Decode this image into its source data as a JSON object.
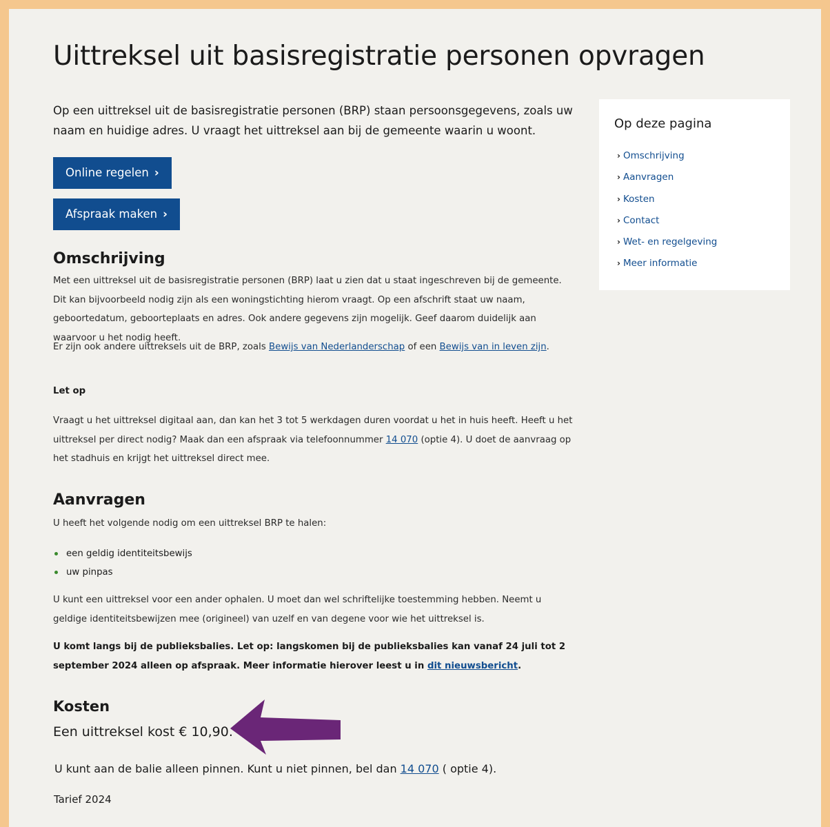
{
  "page": {
    "title": "Uittreksel uit basisregistratie personen opvragen",
    "intro": "Op een uittreksel uit de basisregistratie personen (BRP) staan persoonsgegevens, zoals uw naam en huidige adres. U vraagt het uittreksel aan bij de gemeente waarin u woont."
  },
  "buttons": {
    "online": "Online regelen",
    "afspraak": "Afspraak maken",
    "chevron": "›"
  },
  "omschrijving": {
    "heading": "Omschrijving",
    "p1": "Met een uittreksel uit de basisregistratie personen (BRP) laat u zien dat u staat ingeschreven bij de gemeente. Dit kan bijvoorbeeld nodig zijn als een woningstichting hierom vraagt. Op een afschrift staat uw naam, geboortedatum, geboorteplaats en adres. Ook andere gegevens zijn mogelijk. Geef daarom duidelijk aan waarvoor u het nodig heeft.",
    "p2_before": "Er zijn ook andere uittreksels uit de BRP, zoals ",
    "p2_link1": "Bewijs van Nederlanderschap",
    "p2_mid": " of een ",
    "p2_link2": "Bewijs van in leven zijn",
    "p2_end": ".",
    "letop_label": "Let op",
    "letop_before": "Vraagt u het uittreksel digitaal aan, dan kan het 3 tot 5 werkdagen duren voordat u het in huis heeft. Heeft u het uittreksel per direct nodig? Maak dan een afspraak via telefoonnummer ",
    "letop_phone": "14 070",
    "letop_after": " (optie 4). U doet de aanvraag op het stadhuis en krijgt het uittreksel direct mee."
  },
  "aanvragen": {
    "heading": "Aanvragen",
    "intro": "U heeft het volgende nodig om een uittreksel BRP te halen:",
    "items": [
      "een geldig identiteitsbewijs",
      "uw pinpas"
    ],
    "p2": "U kunt een uittreksel voor een ander ophalen. U moet dan wel schriftelijke toestemming hebben. Neemt u geldige identiteitsbewijzen mee (origineel) van uzelf en van degene voor wie het uittreksel is.",
    "notice_before": "U komt langs bij de publieksbalies. Let op: langskomen bij de publieksbalies kan vanaf 24 juli tot 2 september 2024 alleen op afspraak. Meer informatie hierover leest u in ",
    "notice_link": "dit nieuwsbericht",
    "notice_end": "."
  },
  "kosten": {
    "heading": "Kosten",
    "price": "Een uittreksel kost € 10,90.",
    "pay_before": "U kunt aan de balie alleen pinnen. Kunt u niet pinnen, bel dan ",
    "pay_phone": "14 070",
    "pay_after": " ( optie 4).",
    "tarief": "Tarief 2024"
  },
  "sidebar": {
    "title": "Op deze pagina",
    "chevron": "›",
    "items": [
      "Omschrijving",
      "Aanvragen",
      "Kosten",
      "Contact",
      "Wet- en regelgeving",
      "Meer informatie"
    ]
  },
  "colors": {
    "frame": "#f5c78e",
    "page_bg": "#f2f1ed",
    "button": "#114d8f",
    "link": "#114d8f",
    "arrow": "#6a2677",
    "bullet": "#3a8a2c"
  }
}
